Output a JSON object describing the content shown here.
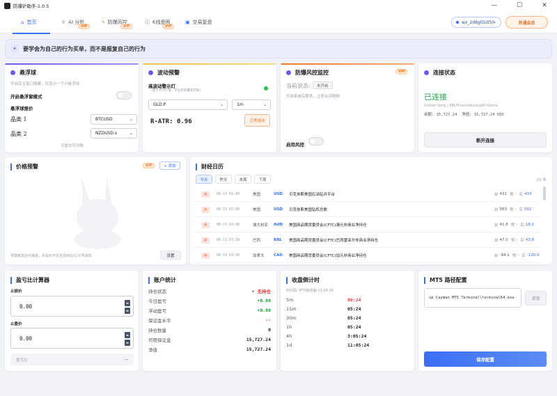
{
  "window": {
    "title": "防爆铲助手-1.0.5",
    "minimize": "—",
    "maximize": "☐",
    "close": "✕"
  },
  "nav": {
    "tabs": [
      {
        "label": "首页",
        "icon": "home-icon",
        "vip": false
      },
      {
        "label": "AI 分析",
        "icon": "bulb-icon",
        "vip": true
      },
      {
        "label": "防爆风控",
        "icon": "lightning-icon",
        "vip": true
      },
      {
        "label": "K线盘面",
        "icon": "info-icon",
        "vip": true
      },
      {
        "label": "交易复盘",
        "icon": "monitor-icon",
        "vip": false
      }
    ],
    "vip_label": "VIP",
    "wallet": "wx_2d8glGUt50",
    "member_button": "开通会员"
  },
  "banner": {
    "text": "要学会为自己的行为买单，而不是报复自己的行为"
  },
  "floating_ball": {
    "title": "悬浮球",
    "subtitle": "开启后主窗口隐藏，仅显示一个小悬浮球",
    "toggle_label": "开启悬浮窗模式",
    "quote_label": "悬浮球报价",
    "item1_label": "品类 1",
    "item1_value": "BTCUSD",
    "item2_label": "品类 2",
    "item2_value": "NZDUSD.s",
    "footer": "日盘也可切换"
  },
  "volatility": {
    "title": "波动预警",
    "indicator_label": "高波动警示灯",
    "indicator_sub": "(基于不同计量，专业原则覆盖范围)",
    "symbol": "GLD.P",
    "timeframe": "1m",
    "ratr_label": "R-ATR:",
    "ratr_value": "0.96",
    "status_button": "正常波动"
  },
  "risk": {
    "title": "防爆风控监控",
    "vip": "VIP",
    "state_label": "当前状态:",
    "state_value": "未开启",
    "desc": "开启系统后联系，立即关闭限制",
    "toggle_label": "启用风控"
  },
  "connection": {
    "title": "连接状态",
    "status": "已连接",
    "server": "Xinhan Song | EBCFinancialGroupKY-Demo",
    "balance_label": "余额:",
    "balance": "15,727.24",
    "equity_label": "净值:",
    "equity": "15,727.24",
    "currency": "USD",
    "disconnect_button": "断开连接"
  },
  "price_alert": {
    "title": "价格预警",
    "vip": "VIP",
    "add_button": "+ 添加",
    "footer": "预警触发后可弹窗，并提示开关全局响应/公众号通知",
    "settings_button": "设置"
  },
  "calendar": {
    "title": "财经日历",
    "filters": [
      "今天",
      "昨天",
      "本周",
      "下周"
    ],
    "count": "20 条",
    "rows": [
      {
        "time": "06-13 01:00",
        "country": "美国",
        "currency": "USD",
        "event": "贝克休斯美国石油钻井平台",
        "prev_label": "前",
        "prev": "431",
        "fc_label": "预",
        "fc": "-",
        "act_label": "实",
        "act": "433"
      },
      {
        "time": "06-13 01:00",
        "country": "美国",
        "currency": "USD",
        "event": "贝克休斯美国钻机总数",
        "prev_label": "前",
        "prev": "563",
        "fc_label": "预",
        "fc": "-",
        "act_label": "实",
        "act": "562"
      },
      {
        "time": "06-13 03:30",
        "country": "澳大利亚",
        "currency": "AUD",
        "event": "美国商品期货委员会(CFTC)澳元非商业净持仓",
        "prev_label": "前",
        "prev": "41.8",
        "fc_label": "预",
        "fc": "-",
        "act_label": "实",
        "act": "18.2"
      },
      {
        "time": "06-13 03:30",
        "country": "巴西",
        "currency": "BRL",
        "event": "美国商品期货委员会(CFTC)巴西雷亚尔非商业净持仓",
        "prev_label": "前",
        "prev": "47.0",
        "fc_label": "预",
        "fc": "-",
        "act_label": "实",
        "act": "43.8"
      },
      {
        "time": "06-13 03:30",
        "country": "加拿大",
        "currency": "CAD",
        "event": "美国商品期货委员会(CFTC)加元非商业净持仓",
        "prev_label": "前",
        "prev": "-94.1",
        "fc_label": "预",
        "fc": "-",
        "act_label": "实",
        "act": "-120.0"
      }
    ]
  },
  "pnl_calc": {
    "title": "盈亏比计算器",
    "sl_label": "止损价",
    "sl_value": "0.00",
    "tp_label": "止盈价",
    "tp_value": "0.00",
    "ratio_label": "盈亏比",
    "ratio_value": "--"
  },
  "account": {
    "title": "账户统计",
    "rows": [
      {
        "label": "持仓状态",
        "value": "• 无持仓",
        "color": "#e53935"
      },
      {
        "label": "今日盈亏",
        "value": "+0.00",
        "color": "#1a9d3a"
      },
      {
        "label": "浮动盈亏",
        "value": "+0.00",
        "color": "#1a9d3a"
      },
      {
        "label": "保证金水平",
        "value": "--",
        "color": "#e53935"
      },
      {
        "label": "持仓数量",
        "value": "0",
        "color": "#222"
      },
      {
        "label": "可用保证金",
        "value": "15,727.24",
        "color": "#222"
      },
      {
        "label": "净值",
        "value": "15,727.24",
        "color": "#222"
      }
    ]
  },
  "countdown": {
    "title": "收盘倒计时",
    "server_time": "时间源: MT5服务器 12:04:36",
    "rows": [
      {
        "tf": "5m",
        "value": "00:24",
        "color": "#e53935"
      },
      {
        "tf": "15m",
        "value": "05:24",
        "color": "#222"
      },
      {
        "tf": "30m",
        "value": "05:24",
        "color": "#222"
      },
      {
        "tf": "1h",
        "value": "05:24",
        "color": "#222"
      },
      {
        "tf": "4h",
        "value": "3:05:24",
        "color": "#222"
      },
      {
        "tf": "1d",
        "value": "11:05:24",
        "color": "#222"
      }
    ]
  },
  "mt5": {
    "title": "MT5 路径配置",
    "path": "up Cayman MT5 Terminal\\terminal64.exe·",
    "browse_button": "浏览",
    "save_button": "保存配置"
  }
}
